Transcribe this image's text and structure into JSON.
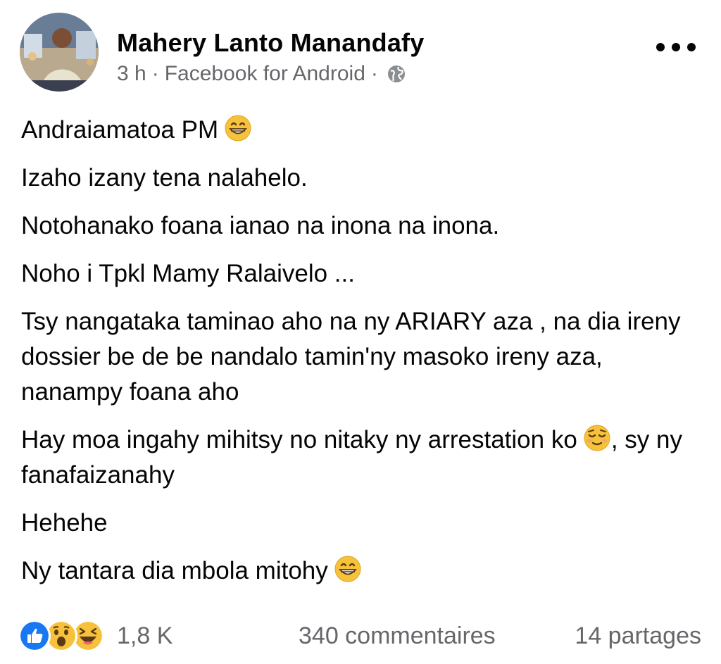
{
  "post": {
    "author": "Mahery Lanto Manandafy",
    "time": "3 h",
    "separator": "·",
    "source": "Facebook for Android",
    "privacy_icon": "globe-icon",
    "more_icon": "more-options-icon",
    "paragraphs": [
      "Andraiamatoa PM",
      "Izaho izany tena nalahelo.",
      "Notohanako foana ianao na inona na inona.",
      "Noho i Tpkl Mamy Ralaivelo ...",
      "Tsy nangataka taminao aho na ny ARIARY aza , na dia ireny dossier be de be nandalo tamin'ny masoko ireny aza, nanampy foana aho",
      "Hay moa ingahy mihitsy no nitaky ny arrestation ko",
      ", sy ny fanafaizanahy",
      "Hehehe",
      "Ny tantara dia mbola mitohy"
    ],
    "emojis": [
      "grinning-face-emoji",
      "relieved-face-emoji",
      "grinning-face-emoji"
    ]
  },
  "footer": {
    "reactions": [
      "like-reaction",
      "wow-reaction",
      "haha-reaction"
    ],
    "reaction_count": "1,8 K",
    "comments": "340 commentaires",
    "shares": "14 partages"
  },
  "colors": {
    "text": "#050505",
    "secondary": "#65676b",
    "like_blue": "#1877f2",
    "emoji_yellow": "#f7c23b"
  }
}
